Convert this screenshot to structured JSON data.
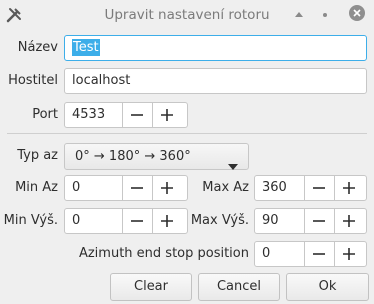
{
  "window": {
    "title": "Upravit nastavení rotoru",
    "icon": "tools-icon",
    "controls": [
      "keep-above-icon",
      "minimize-icon",
      "close-icon"
    ]
  },
  "form": {
    "name_label": "Název",
    "name_value": "Test",
    "host_label": "Hostitel",
    "host_value": "localhost",
    "port_label": "Port",
    "port_value": "4533",
    "type_label": "Typ az",
    "type_value": "0° → 180° → 360°",
    "min_az_label": "Min Az",
    "min_az_value": "0",
    "max_az_label": "Max Az",
    "max_az_value": "360",
    "min_el_label": "Min Výš.",
    "min_el_value": "0",
    "max_el_label": "Max Výš.",
    "max_el_value": "90",
    "endstop_label": "Azimuth end stop position",
    "endstop_value": "0"
  },
  "buttons": {
    "clear": "Clear",
    "cancel": "Cancel",
    "ok": "Ok"
  },
  "colors": {
    "selection": "#3daee9",
    "background": "#efefef"
  }
}
